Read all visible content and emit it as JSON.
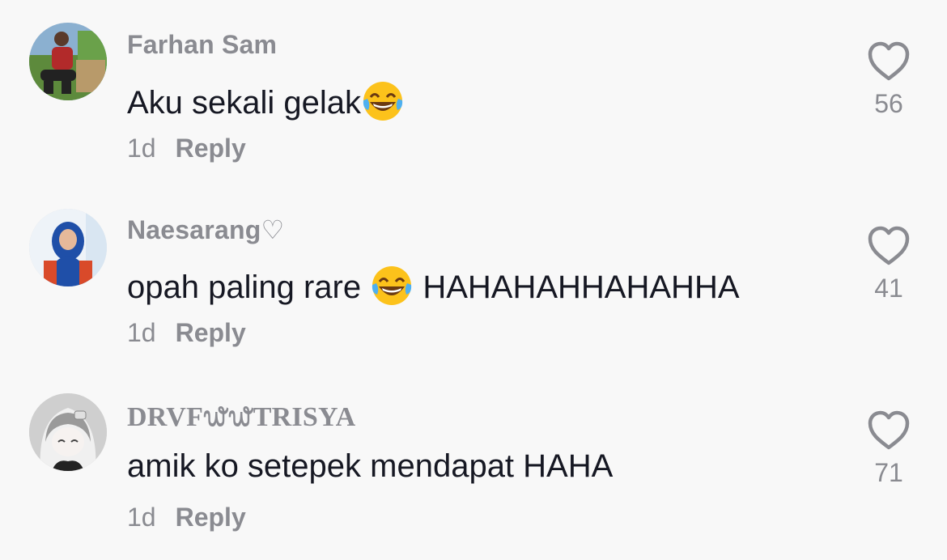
{
  "comments": [
    {
      "username": "Farhan Sam",
      "text_before": "Aku sekali gelak",
      "emoji": "face-with-tears-of-joy",
      "text_after": "",
      "time": "1d",
      "reply_label": "Reply",
      "likes": "56"
    },
    {
      "username": "Naesarang♡",
      "text_before": "opah paling rare ",
      "emoji": "face-with-tears-of-joy",
      "text_after": " HAHAHAHHAHAHHA",
      "time": "1d",
      "reply_label": "Reply",
      "likes": "41"
    },
    {
      "username": "DRVF᭙᭙TRISYA",
      "text_before": "amik ko setepek mendapat HAHA",
      "text_after": "",
      "time": "1d",
      "reply_label": "Reply",
      "likes": "71"
    }
  ],
  "icons": {
    "like": "heart-outline-icon",
    "emoji": "face-with-tears-of-joy-icon"
  },
  "colors": {
    "background": "#f8f8f8",
    "primary_text": "#161823",
    "secondary_text": "#8a8b91"
  }
}
